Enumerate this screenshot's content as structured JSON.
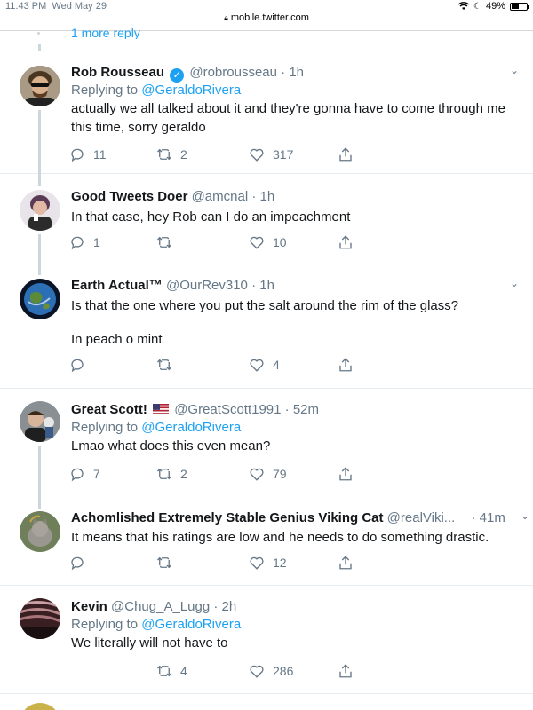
{
  "status_bar": {
    "time": "11:43 PM",
    "date": "Wed May 29",
    "battery": "49%"
  },
  "browser": {
    "url": "mobile.twitter.com"
  },
  "more_replies": "1 more reply",
  "tweets": [
    {
      "name": "Rob Rousseau",
      "verified": true,
      "handle": "@robrousseau",
      "sep": "·",
      "time": "1h",
      "replying_prefix": "Replying to",
      "replying_to": "@GeraldoRivera",
      "text": "actually we all talked about it and they're gonna have to come through me this time, sorry geraldo",
      "replies": "11",
      "retweets": "2",
      "likes": "317"
    },
    {
      "name": "Good Tweets Doer",
      "handle": "@amcnal",
      "sep": "·",
      "time": "1h",
      "text": "In that case, hey Rob can I do an impeachment",
      "replies": "1",
      "retweets": "",
      "likes": "10"
    },
    {
      "name": "Earth Actual™",
      "handle": "@OurRev310",
      "sep": "·",
      "time": "1h",
      "text_line1": "Is that the one where you put the salt around the rim of the glass?",
      "text_line2": "In peach o mint",
      "replies": "",
      "retweets": "",
      "likes": "4"
    },
    {
      "name": "Great Scott!",
      "handle": "@GreatScott1991",
      "sep": "·",
      "time": "52m",
      "replying_prefix": "Replying to",
      "replying_to": "@GeraldoRivera",
      "text": "Lmao what does this even mean?",
      "replies": "7",
      "retweets": "2",
      "likes": "79"
    },
    {
      "name": "Achomlished Extremely Stable Genius Viking Cat",
      "handle": "@realViki...",
      "sep": "·",
      "time": "41m",
      "text": "It means that his ratings are low and he needs to do something drastic.",
      "replies": "",
      "retweets": "",
      "likes": "12"
    },
    {
      "name": "Kevin",
      "handle": "@Chug_A_Lugg",
      "sep": "·",
      "time": "2h",
      "replying_prefix": "Replying to",
      "replying_to": "@GeraldoRivera",
      "text": "We literally will not have to",
      "replies": "",
      "retweets": "4",
      "likes": "286"
    }
  ],
  "colors": {
    "accent": "#1da1f2",
    "secondary_text": "#657786",
    "thread_line": "#ccd6dd",
    "divider": "#e6ecf0"
  },
  "icons": [
    "reply-icon",
    "retweet-icon",
    "like-icon",
    "share-icon",
    "verified-icon",
    "chevron-down-icon",
    "lock-icon",
    "wifi-icon",
    "moon-icon",
    "battery-icon"
  ]
}
